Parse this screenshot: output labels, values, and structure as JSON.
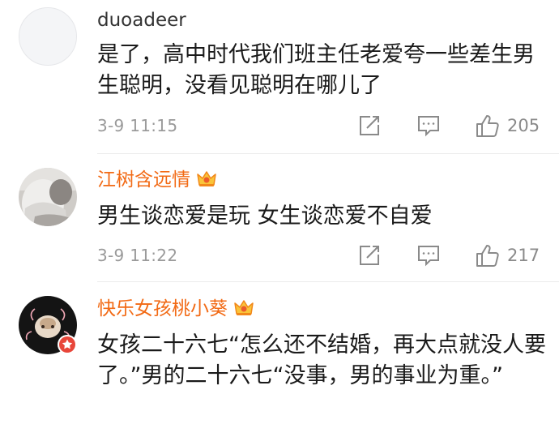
{
  "colors": {
    "vip_name": "#f26a15",
    "body_text": "#1a1a1a",
    "meta_text": "#9a9a9a",
    "badge_red": "#e8463a"
  },
  "comments": [
    {
      "username": "duoadeer",
      "vip": false,
      "text": "是了，高中时代我们班主任老爱夸一些差生男生聪明，没看见聪明在哪儿了",
      "timestamp": "3-9 11:15",
      "likes": "205",
      "icons": [
        "share-icon",
        "reply-icon",
        "like-icon"
      ]
    },
    {
      "username": "江树含远情",
      "vip": true,
      "text": "男生谈恋爱是玩 女生谈恋爱不自爱",
      "timestamp": "3-9 11:22",
      "likes": "217",
      "icons": [
        "share-icon",
        "reply-icon",
        "like-icon"
      ]
    },
    {
      "username": "快乐女孩桃小葵",
      "vip": true,
      "verified_badge": true,
      "text": "女孩二十六七“怎么还不结婚，再大点就没人要了。”男的二十六七“没事，男的事业为重。”"
    }
  ]
}
